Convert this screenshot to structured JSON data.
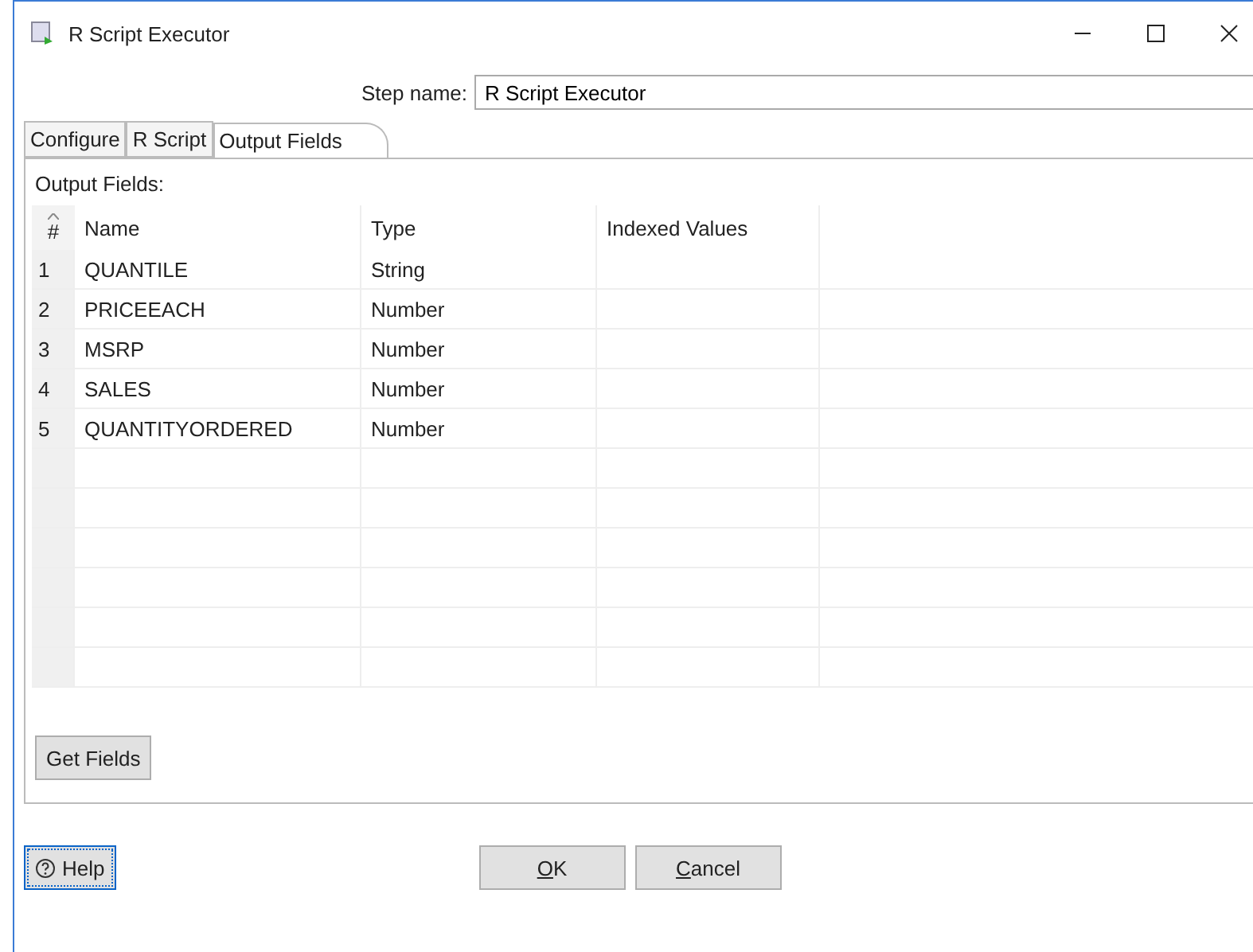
{
  "window": {
    "title": "R Script Executor"
  },
  "step_name": {
    "label": "Step name:",
    "value": "R Script Executor"
  },
  "tabs": [
    {
      "label": "Configure",
      "selected": false
    },
    {
      "label": "R Script",
      "selected": false
    },
    {
      "label": "Output Fields",
      "selected": true
    }
  ],
  "section_label": "Output Fields:",
  "table": {
    "columns": [
      "#",
      "Name",
      "Type",
      "Indexed Values"
    ],
    "rows": [
      [
        "1",
        "QUANTILE",
        "String",
        ""
      ],
      [
        "2",
        "PRICEEACH",
        "Number",
        ""
      ],
      [
        "3",
        "MSRP",
        "Number",
        ""
      ],
      [
        "4",
        "SALES",
        "Number",
        ""
      ],
      [
        "5",
        "QUANTITYORDERED",
        "Number",
        ""
      ]
    ]
  },
  "get_fields_button": "Get Fields",
  "help_button": {
    "label": "Help",
    "focused": true
  },
  "buttons": [
    {
      "label": "OK",
      "mnemonic_first": true
    },
    {
      "label": "Cancel",
      "mnemonic_first": true
    }
  ]
}
